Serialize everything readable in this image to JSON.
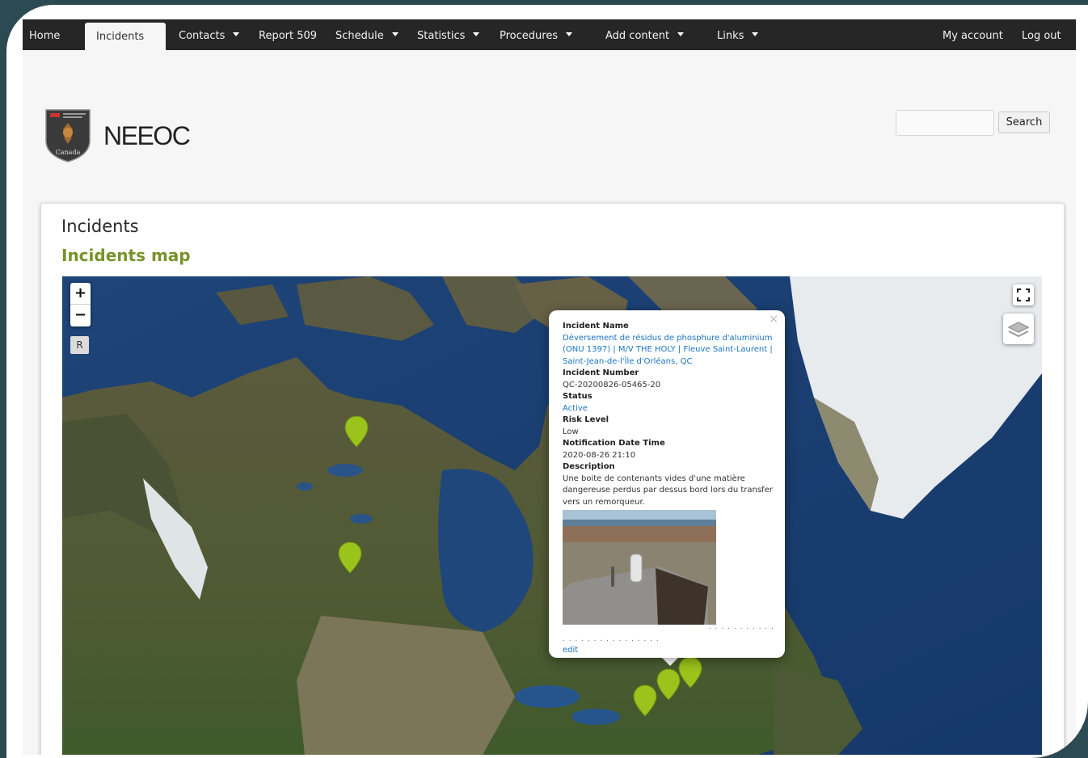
{
  "nav": {
    "home": "Home",
    "incidents": "Incidents",
    "contacts": "Contacts",
    "report509": "Report 509",
    "schedule": "Schedule",
    "statistics": "Statistics",
    "procedures": "Procedures",
    "add_content": "Add content",
    "links": "Links",
    "my_account": "My account",
    "log_out": "Log out"
  },
  "header": {
    "site_name": "NEEOC",
    "logo_text": "Canada",
    "search_value": "",
    "search_button": "Search"
  },
  "content": {
    "page_title": "Incidents",
    "section_title": "Incidents map"
  },
  "map": {
    "zoom_in": "+",
    "zoom_out": "−",
    "reset": "R",
    "marker_color": "#9ac31c",
    "popup": {
      "close": "×",
      "incident_name_label": "Incident Name",
      "incident_name": "Déversement de résidus de phosphure d'aluminium (ONU 1397) | M/V THE HOLY | Fleuve Saint-Laurent | Saint-Jean-de-l'Île d'Orléans, QC",
      "incident_number_label": "Incident Number",
      "incident_number": "QC-20200826-05465-20",
      "status_label": "Status",
      "status": "Active",
      "risk_label": "Risk Level",
      "risk": "Low",
      "notification_label": "Notification Date Time",
      "notification": "2020-08-26 21:10",
      "description_label": "Description",
      "description": "Une boite de contenants vides d'une matière dangereuse perdus par dessus bord lors du transfer vers un remorqueur.",
      "edit": "edit"
    }
  },
  "colors": {
    "nav_bg": "#262626",
    "accent_green": "#79922a",
    "link_blue": "#1a73c1"
  }
}
